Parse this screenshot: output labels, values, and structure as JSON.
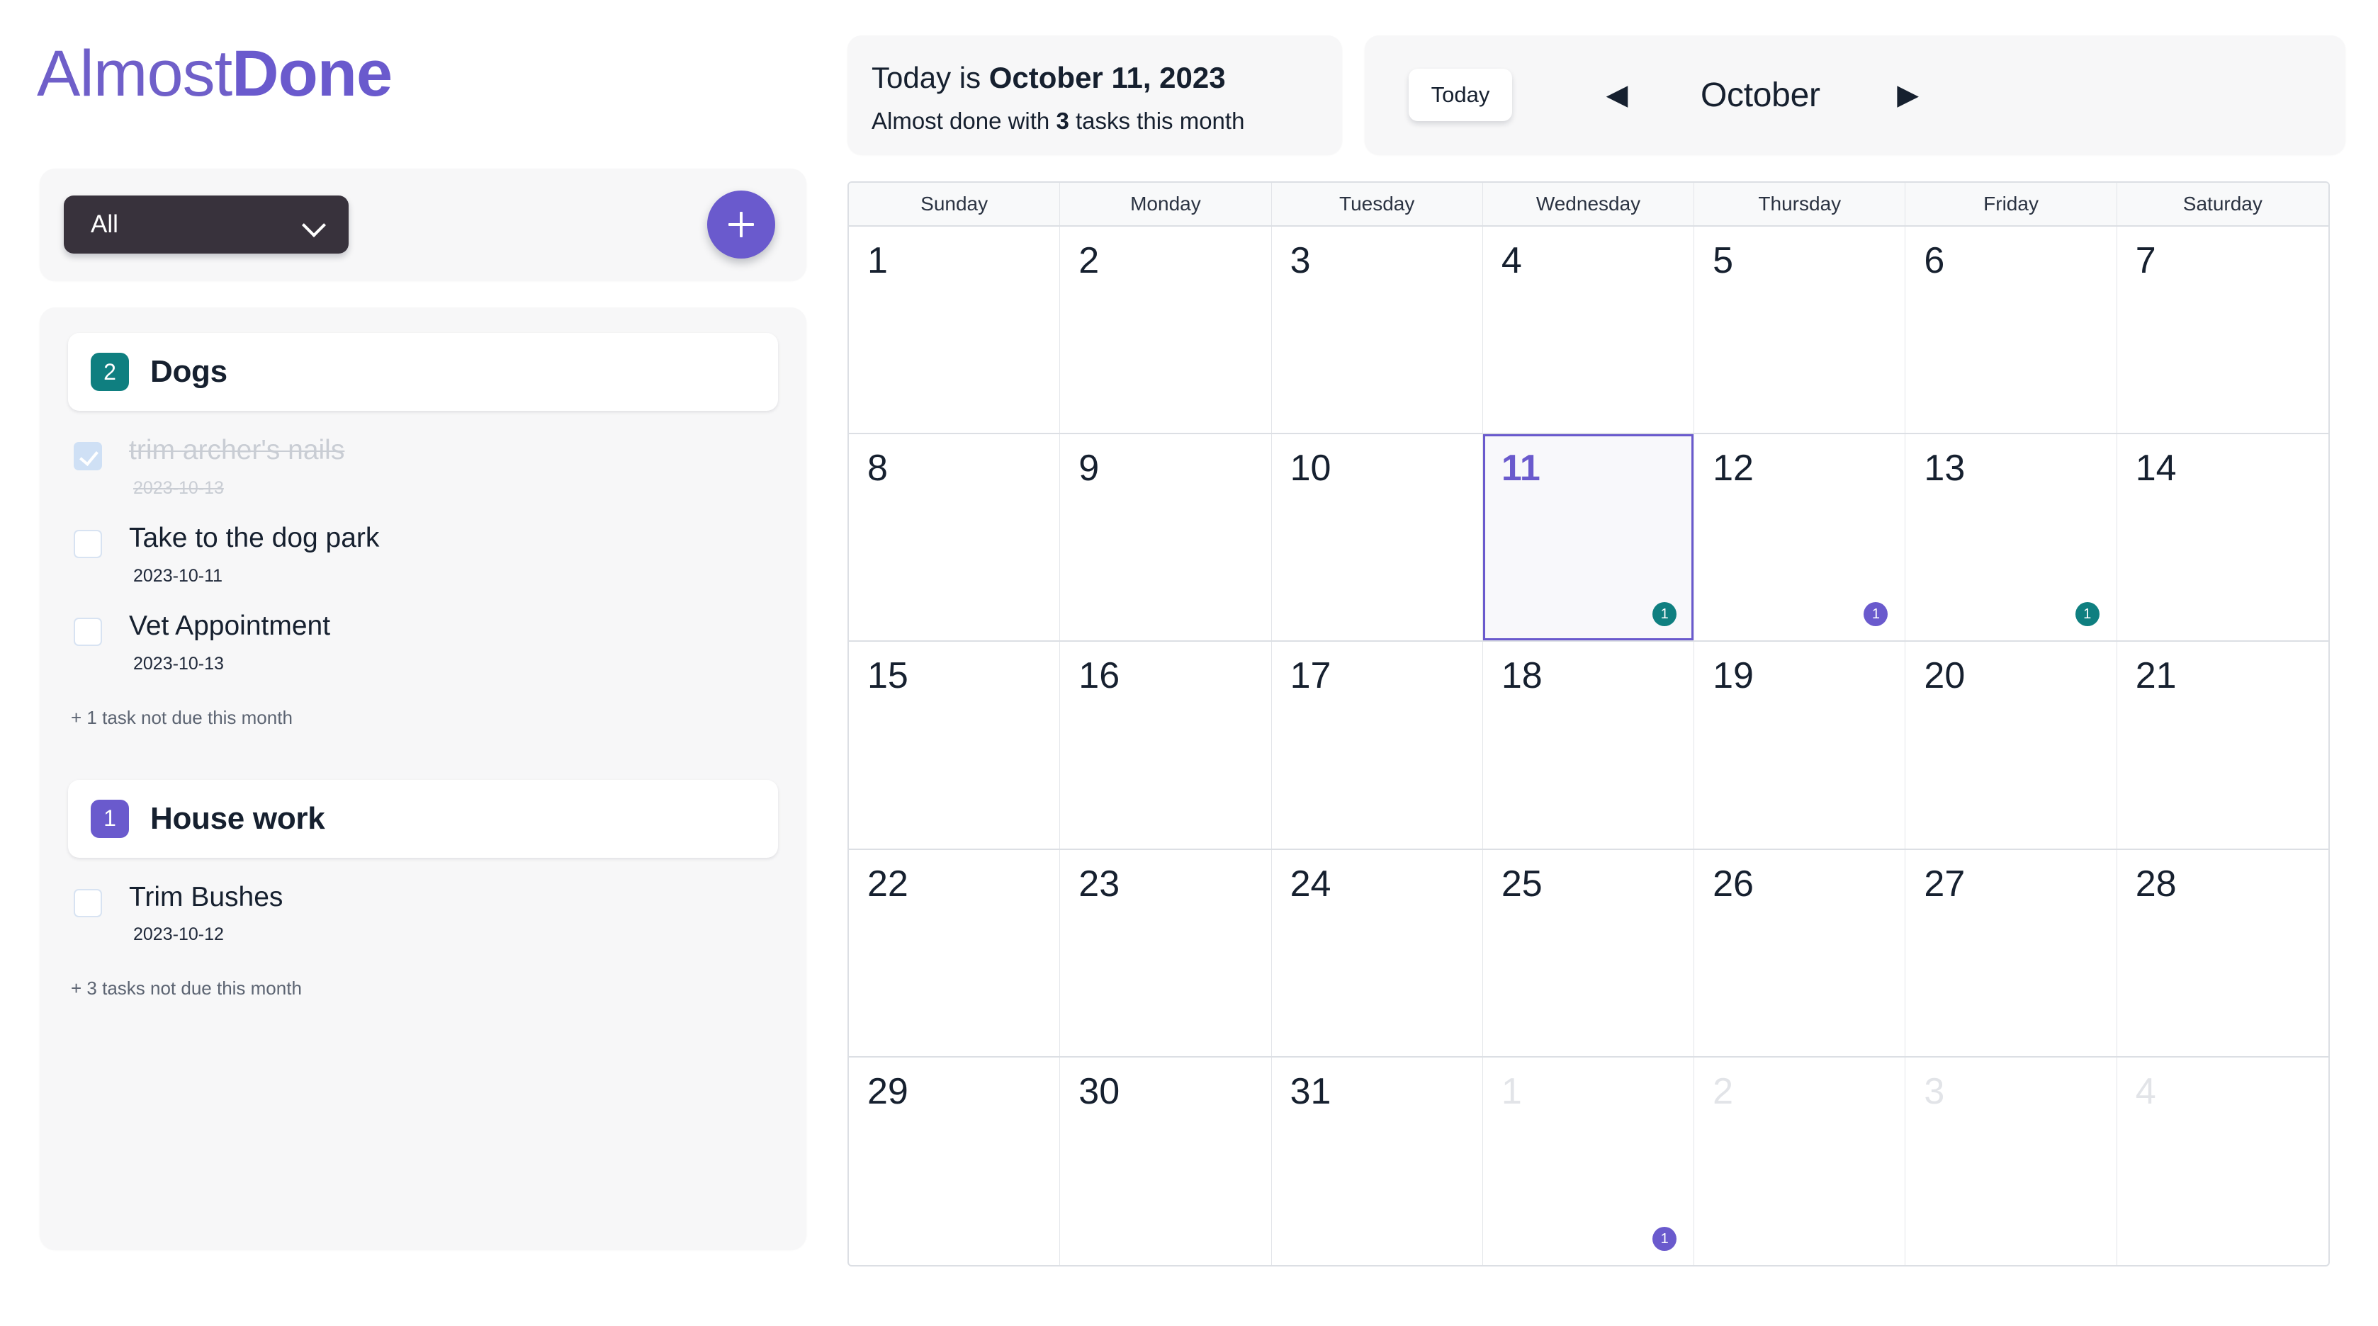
{
  "brand": {
    "part1": "Almost",
    "part2": "Done"
  },
  "filter": {
    "selected": "All",
    "options": [
      "All"
    ],
    "chevron_icon": "chevron-down-icon",
    "add_icon": "plus-icon"
  },
  "today_card": {
    "prefix": "Today is ",
    "date": "October 11, 2023",
    "sub_prefix": "Almost done with ",
    "sub_count": "3",
    "sub_suffix": " tasks this month"
  },
  "month_nav": {
    "today_label": "Today",
    "prev_icon": "triangle-left-icon",
    "prev_glyph": "◀",
    "next_icon": "triangle-right-icon",
    "next_glyph": "▶",
    "month_label": "October"
  },
  "colors": {
    "accent_purple": "#6a5acd",
    "badge_teal": "#0f7f80",
    "badge_purple": "#6a5acd",
    "panel_bg": "#f7f7f8",
    "text_dark": "#16202f",
    "muted": "#c9cdd4"
  },
  "groups": [
    {
      "name": "Dogs",
      "count": "2",
      "badge_color": "#0f7f80",
      "tasks": [
        {
          "title": "trim archer's nails",
          "date": "2023-10-13",
          "done": true
        },
        {
          "title": "Take to the dog park",
          "date": "2023-10-11",
          "done": false
        },
        {
          "title": "Vet Appointment",
          "date": "2023-10-13",
          "done": false
        }
      ],
      "more_note": "+ 1 task not due this month"
    },
    {
      "name": "House work",
      "count": "1",
      "badge_color": "#6a5acd",
      "tasks": [
        {
          "title": "Trim Bushes",
          "date": "2023-10-12",
          "done": false
        }
      ],
      "more_note": "+ 3 tasks not due this month"
    }
  ],
  "calendar": {
    "weekdays": [
      "Sunday",
      "Monday",
      "Tuesday",
      "Wednesday",
      "Thursday",
      "Friday",
      "Saturday"
    ],
    "weeks": [
      [
        {
          "day": "1",
          "other": false
        },
        {
          "day": "2",
          "other": false
        },
        {
          "day": "3",
          "other": false
        },
        {
          "day": "4",
          "other": false
        },
        {
          "day": "5",
          "other": false
        },
        {
          "day": "6",
          "other": false
        },
        {
          "day": "7",
          "other": false
        }
      ],
      [
        {
          "day": "8",
          "other": false
        },
        {
          "day": "9",
          "other": false
        },
        {
          "day": "10",
          "other": false
        },
        {
          "day": "11",
          "other": false,
          "today": true,
          "badge": "1",
          "badge_color": "#0f7f80"
        },
        {
          "day": "12",
          "other": false,
          "badge": "1",
          "badge_color": "#6a5acd"
        },
        {
          "day": "13",
          "other": false,
          "badge": "1",
          "badge_color": "#0f7f80"
        },
        {
          "day": "14",
          "other": false
        }
      ],
      [
        {
          "day": "15",
          "other": false
        },
        {
          "day": "16",
          "other": false
        },
        {
          "day": "17",
          "other": false
        },
        {
          "day": "18",
          "other": false
        },
        {
          "day": "19",
          "other": false
        },
        {
          "day": "20",
          "other": false
        },
        {
          "day": "21",
          "other": false
        }
      ],
      [
        {
          "day": "22",
          "other": false
        },
        {
          "day": "23",
          "other": false
        },
        {
          "day": "24",
          "other": false
        },
        {
          "day": "25",
          "other": false
        },
        {
          "day": "26",
          "other": false
        },
        {
          "day": "27",
          "other": false
        },
        {
          "day": "28",
          "other": false
        }
      ],
      [
        {
          "day": "29",
          "other": false
        },
        {
          "day": "30",
          "other": false
        },
        {
          "day": "31",
          "other": false
        },
        {
          "day": "1",
          "other": true,
          "badge": "1",
          "badge_color": "#6a5acd"
        },
        {
          "day": "2",
          "other": true
        },
        {
          "day": "3",
          "other": true
        },
        {
          "day": "4",
          "other": true
        }
      ]
    ]
  }
}
